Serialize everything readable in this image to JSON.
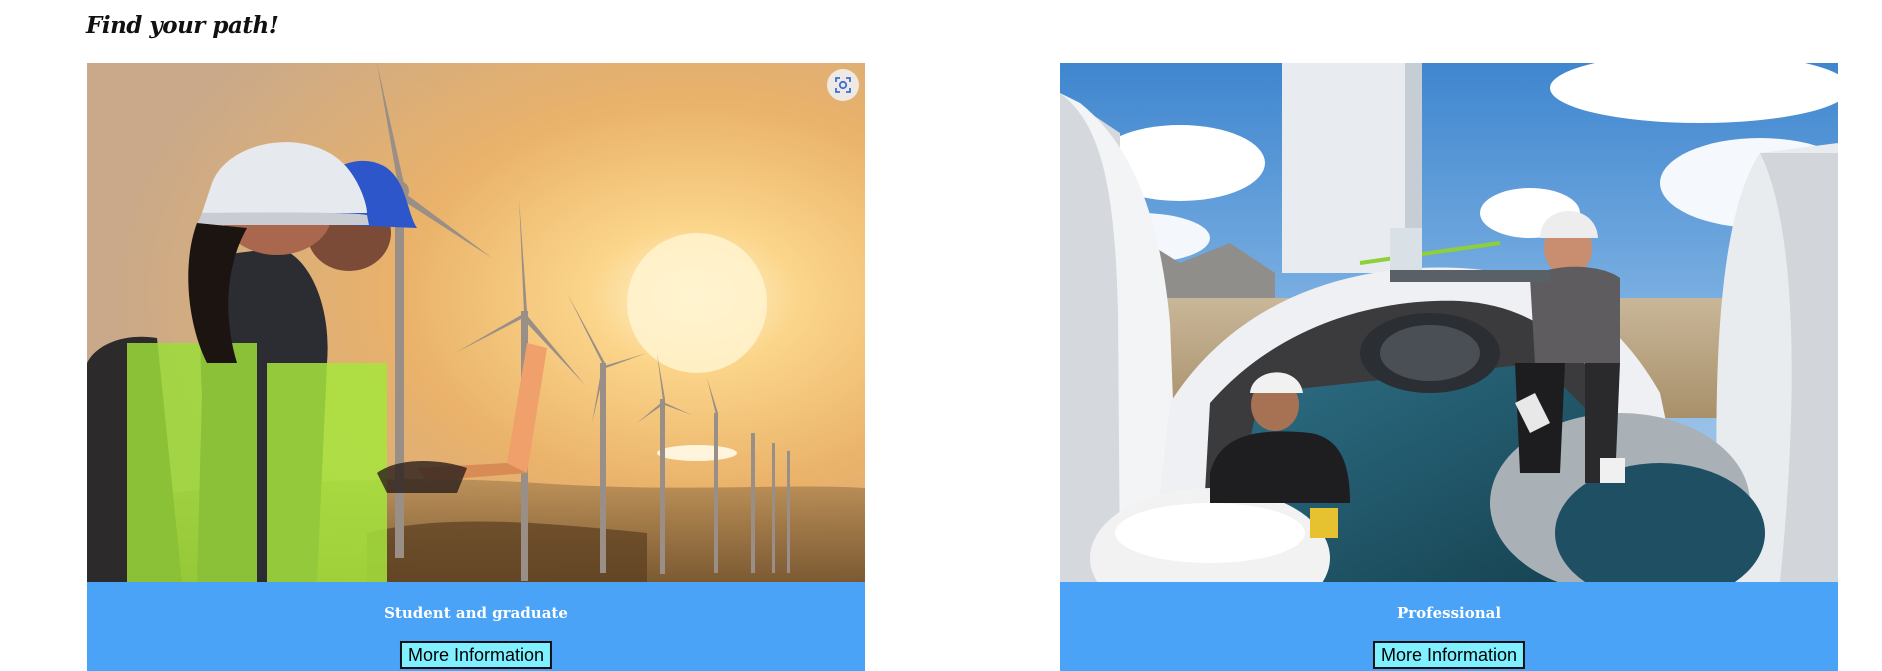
{
  "page": {
    "title": "Find your path!"
  },
  "cards": [
    {
      "label": "Student and graduate",
      "button_label": "More Information",
      "image_icon": "visual-search-icon"
    },
    {
      "label": "Professional",
      "button_label": "More Information"
    }
  ],
  "colors": {
    "card_footer": "#4aa3f6",
    "button_bg": "#7ff0ff",
    "title_text": "#111111"
  }
}
